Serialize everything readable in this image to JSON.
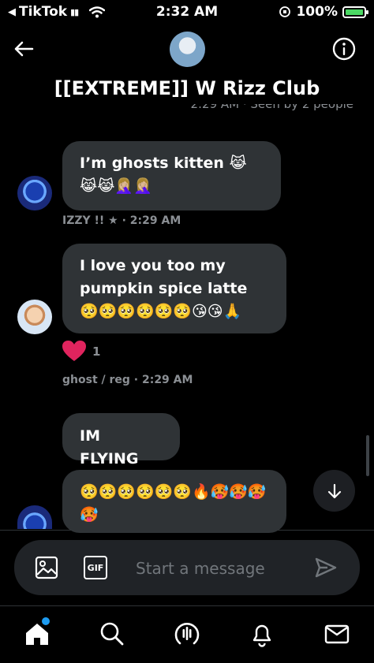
{
  "status_bar": {
    "carrier": "TikTok",
    "time": "2:32 AM",
    "battery": "100%"
  },
  "header": {
    "title": "[[EXTREME]] W Rizz Club",
    "seen_text": "2:29 AM · Seen by 2 people"
  },
  "messages": [
    {
      "text": "I’m ghosts kitten 😹😹😹🤦🏼‍♀️🤦🏼‍♀️",
      "meta": "IZZY !! ★ · 2:29 AM"
    },
    {
      "text": "I love you too my pumpkin spice latte 🥺🥺🥺🥺🥺🥺😘😘🙏",
      "meta": "ghost / reg · 2:29 AM",
      "reaction_emoji": "❤️",
      "reaction_count": "1"
    },
    {
      "text": "IM FLYING"
    },
    {
      "text": "🥺🥺🥺🥺🥺🥺🔥🥵🥵🥵🥵"
    }
  ],
  "composer": {
    "placeholder": "Start a message"
  },
  "icons": {
    "back": "arrow-left-icon",
    "info": "info-icon",
    "image": "image-icon",
    "gif": "GIF",
    "send": "send-icon",
    "scroll_down": "arrow-down-icon",
    "tabs": [
      "home-icon",
      "search-icon",
      "spaces-icon",
      "notifications-icon",
      "messages-icon"
    ]
  },
  "colors": {
    "accent": "#1d9bf0",
    "bubble": "#2f3336",
    "battery": "#4cd964",
    "heart": "#e0245e"
  }
}
